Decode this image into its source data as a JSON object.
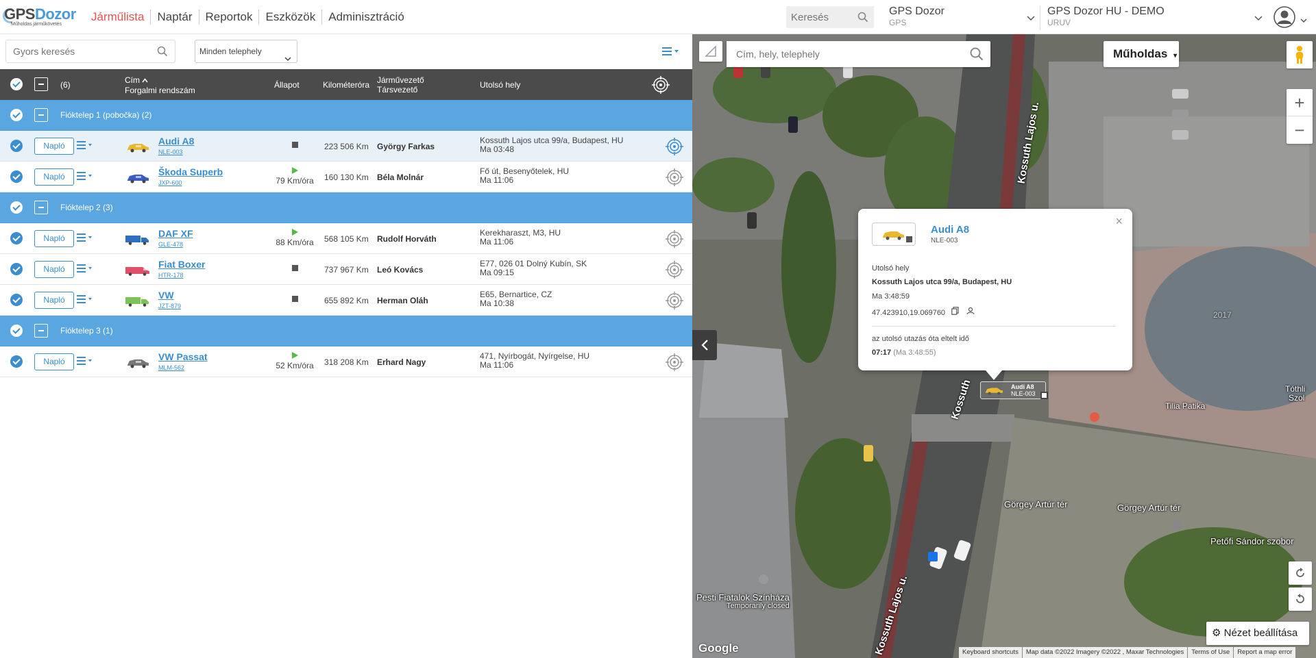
{
  "logo": {
    "part1": "GPS",
    "part2": "Dozor",
    "tagline": "Műholdas járműkövetés"
  },
  "nav": {
    "items": [
      "Járműlista",
      "Naptár",
      "Reportok",
      "Eszközök",
      "Adminisztráció"
    ]
  },
  "header": {
    "search_placeholder": "Keresés",
    "account1": {
      "title": "GPS Dozor",
      "subtitle": "GPS"
    },
    "account2": {
      "title": "GPS Dozor HU - DEMO",
      "subtitle": "URUV"
    }
  },
  "filters": {
    "quick_search_placeholder": "Gyors keresés",
    "site_select_value": "Minden telephely"
  },
  "table": {
    "count": "(6)",
    "headers": {
      "title": "Cím",
      "plate": "Forgalmi rendszám",
      "status": "Állapot",
      "odometer": "Kilométeróra",
      "driver": "Járművezető",
      "codriver": "Társvezető",
      "last_location": "Utolsó hely"
    },
    "naplo_label": "Napló",
    "groups": [
      {
        "label": "Fióktelep 1 (pobočka) (2)",
        "vehicles": [
          {
            "name": "Audi A8",
            "plate": "NLE-003",
            "status": "stopped",
            "speed": "",
            "km": "223 506 Km",
            "driver": "György Farkas",
            "loc1": "Kossuth Lajos utca 99/a, Budapest, HU",
            "loc2": "Ma 03:48",
            "icon_color": "#e8b830",
            "icon_type": "car",
            "selected": true
          },
          {
            "name": "Škoda Superb",
            "plate": "JXP-600",
            "status": "moving",
            "speed": "79 Km/óra",
            "km": "160 130 Km",
            "driver": "Béla Molnár",
            "loc1": "Fő út, Besenyőtelek, HU",
            "loc2": "Ma 11:06",
            "icon_color": "#3a5bc7",
            "icon_type": "car",
            "selected": false
          }
        ]
      },
      {
        "label": "Fióktelep 2 (3)",
        "vehicles": [
          {
            "name": "DAF XF",
            "plate": "GLE-478",
            "status": "moving",
            "speed": "88 Km/óra",
            "km": "568 105 Km",
            "driver": "Rudolf Horváth",
            "loc1": "Kerekharaszt, M3, HU",
            "loc2": "Ma 11:06",
            "icon_color": "#2f6fbf",
            "icon_type": "truck",
            "selected": false
          },
          {
            "name": "Fiat Boxer",
            "plate": "HTR-178",
            "status": "stopped",
            "speed": "",
            "km": "737 967 Km",
            "driver": "Leó Kovács",
            "loc1": "E77, 026 01 Dolný Kubín, SK",
            "loc2": "Ma 09:15",
            "icon_color": "#e0506a",
            "icon_type": "van",
            "selected": false
          },
          {
            "name": "VW",
            "plate": "JZT-879",
            "status": "stopped",
            "speed": "",
            "km": "655 892 Km",
            "driver": "Herman Oláh",
            "loc1": "E65, Bernartice, CZ",
            "loc2": "Ma 10:38",
            "icon_color": "#7cc45a",
            "icon_type": "truck",
            "selected": false
          }
        ]
      },
      {
        "label": "Fióktelep 3 (1)",
        "vehicles": [
          {
            "name": "VW Passat",
            "plate": "MLM-562",
            "status": "moving",
            "speed": "52 Km/óra",
            "km": "318 208 Km",
            "driver": "Erhard Nagy",
            "loc1": "471, Nyírbogát, Nyírgelse, HU",
            "loc2": "Ma 11:06",
            "icon_color": "#777777",
            "icon_type": "car",
            "selected": false
          }
        ]
      }
    ]
  },
  "map": {
    "search_placeholder": "Cím, hely, telephely",
    "map_type": "Műholdas",
    "view_settings": "Nézet beállítása",
    "google": "Google",
    "attribution": [
      "Keyboard shortcuts",
      "Map data ©2022 Imagery ©2022 , Maxar Technologies",
      "Terms of Use",
      "Report a map error"
    ],
    "labels": {
      "street1": "Kossuth Lajos u.",
      "street2": "Kossuth Lajos u.",
      "street3": "Kossuth",
      "square1": "Görgey Artúr tér",
      "square2": "Görgey Artúr tér",
      "pharmacy": "Tilia Patika",
      "statue": "Petőfi Sándor szobor",
      "theatre": "Pesti Fiatalok Színháza",
      "theatre_note": "Temporarily closed",
      "edge1": "Tóthli",
      "edge2": "Szol",
      "building_no": "2017"
    },
    "popup": {
      "name": "Audi A8",
      "plate": "NLE-003",
      "last_place_label": "Utolsó hely",
      "address": "Kossuth Lajos utca 99/a, Budapest, HU",
      "time": "Ma 3:48:59",
      "coords": "47.423910,19.069760",
      "elapsed_label": "az utolsó utazás óta eltelt idő",
      "elapsed": "07:17",
      "elapsed_detail": "(Ma 3:48:55)"
    },
    "marker": {
      "name": "Audi A8",
      "plate": "NLE-003"
    }
  }
}
